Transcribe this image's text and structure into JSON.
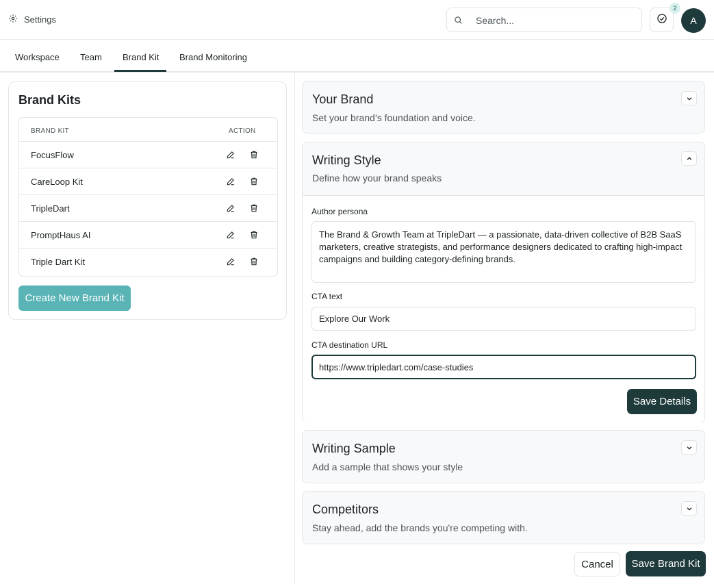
{
  "header": {
    "settings_label": "Settings",
    "search_placeholder": "Search...",
    "notification_count": "2",
    "avatar_initial": "A"
  },
  "tabs": [
    {
      "label": "Workspace",
      "active": false
    },
    {
      "label": "Team",
      "active": false
    },
    {
      "label": "Brand Kit",
      "active": true
    },
    {
      "label": "Brand Monitoring",
      "active": false
    }
  ],
  "brand_kits": {
    "title": "Brand Kits",
    "columns": [
      "BRAND KIT",
      "ACTION"
    ],
    "rows": [
      {
        "name": "FocusFlow"
      },
      {
        "name": "CareLoop Kit"
      },
      {
        "name": "TripleDart"
      },
      {
        "name": "PromptHaus AI"
      },
      {
        "name": "Triple Dart Kit"
      }
    ],
    "create_button": "Create New Brand Kit"
  },
  "sections": {
    "your_brand": {
      "title": "Your Brand",
      "subtitle": "Set your brand’s foundation and voice.",
      "expanded": false
    },
    "writing_style": {
      "title": "Writing Style",
      "subtitle": "Define how your brand speaks",
      "expanded": true,
      "author_persona_label": "Author persona",
      "author_persona_value": "The Brand & Growth Team at TripleDart — a passionate, data-driven collective of B2B SaaS marketers, creative strategists, and performance designers dedicated to crafting high-impact campaigns and building category-defining brands.",
      "cta_text_label": "CTA text",
      "cta_text_value": "Explore Our Work",
      "cta_url_label": "CTA destination URL",
      "cta_url_value": "https://www.tripledart.com/case-studies",
      "save_button": "Save Details"
    },
    "writing_sample": {
      "title": "Writing Sample",
      "subtitle": "Add a sample that shows your style",
      "expanded": false
    },
    "competitors": {
      "title": "Competitors",
      "subtitle": "Stay ahead, add the brands you're competing with.",
      "expanded": false
    }
  },
  "footer": {
    "cancel_button": "Cancel",
    "save_button": "Save Brand Kit"
  },
  "colors": {
    "primary": "#1f3a3b",
    "accent": "#5ab4b6",
    "border": "#e3e6e7"
  }
}
